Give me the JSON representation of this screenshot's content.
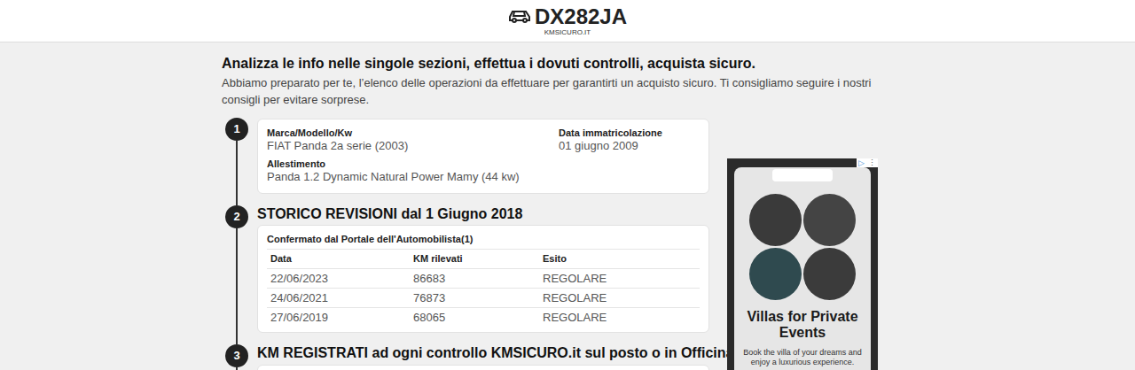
{
  "header": {
    "plate": "DX282JA",
    "site": "KMSICURO.IT"
  },
  "intro": {
    "title": "Analizza le info nelle singole sezioni, effettua i dovuti controlli, acquista sicuro.",
    "text": "Abbiamo preparato per te, l’elenco delle operazioni da effettuare per garantirti un acquisto sicuro. Ti consigliamo seguire i nostri consigli per evitare sorprese."
  },
  "vehicle": {
    "number": "1",
    "fields": [
      {
        "label": "Marca/Modello/Kw",
        "value": "FIAT Panda 2a serie (2003)"
      },
      {
        "label": "Data immatricolazione",
        "value": "01 giugno 2009"
      },
      {
        "label": "Allestimento",
        "value": "Panda 1.2 Dynamic Natural Power Mamy (44 kw)"
      }
    ]
  },
  "revisions": {
    "number": "2",
    "title": "STORICO REVISIONI dal 1 Giugno 2018",
    "source": "Confermato dal Portale dell'Automobilista(1)",
    "columns": [
      "Data",
      "KM rilevati",
      "Esito"
    ],
    "rows": [
      [
        "22/06/2023",
        "86683",
        "REGOLARE"
      ],
      [
        "24/06/2021",
        "76873",
        "REGOLARE"
      ],
      [
        "27/06/2019",
        "68065",
        "REGOLARE"
      ]
    ]
  },
  "km_records": {
    "number": "3",
    "title": "KM REGISTRATI ad ogni controllo KMSICURO.it sul posto o in Officina"
  },
  "ad": {
    "badge": "▷",
    "menu": "⋮",
    "title": "Villas for Private Events",
    "text": "Book the villa of your dreams and enjoy a luxurious experience."
  }
}
